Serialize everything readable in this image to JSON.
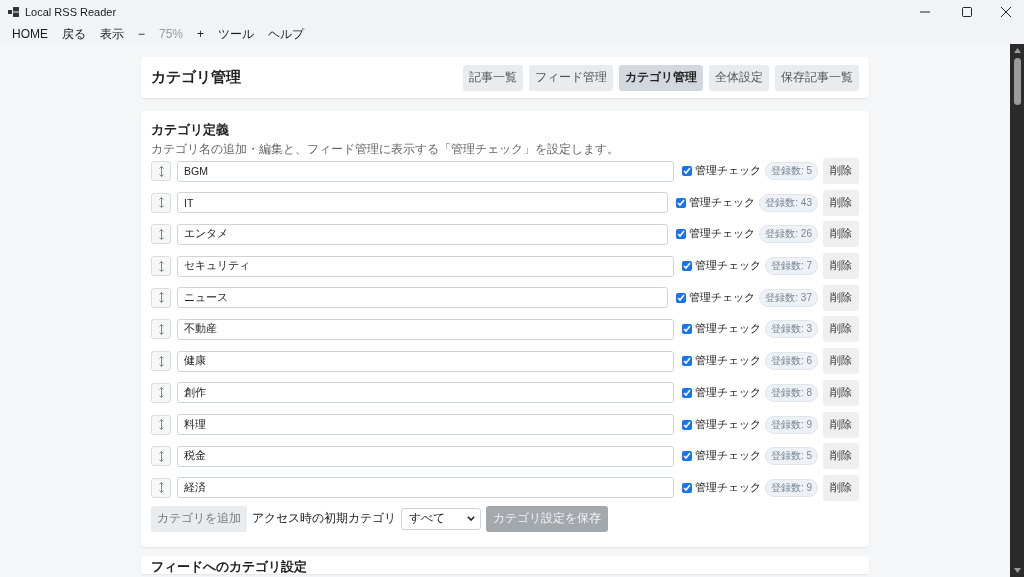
{
  "window": {
    "title": "Local RSS Reader"
  },
  "menu": [
    {
      "label": "HOME",
      "disabled": false
    },
    {
      "label": "戻る",
      "disabled": false
    },
    {
      "label": "表示",
      "disabled": false
    },
    {
      "label": "−",
      "disabled": false
    },
    {
      "label": "75%",
      "disabled": true
    },
    {
      "label": "+",
      "disabled": false
    },
    {
      "label": "ツール",
      "disabled": false
    },
    {
      "label": "ヘルプ",
      "disabled": false
    }
  ],
  "header": {
    "title": "カテゴリ管理",
    "nav": [
      {
        "label": "記事一覧",
        "selected": false
      },
      {
        "label": "フィード管理",
        "selected": false
      },
      {
        "label": "カテゴリ管理",
        "selected": true
      },
      {
        "label": "全体設定",
        "selected": false
      },
      {
        "label": "保存記事一覧",
        "selected": false
      }
    ]
  },
  "category_section": {
    "title": "カテゴリ定義",
    "description": "カテゴリ名の追加・編集と、フィード管理に表示する「管理チェック」を設定します。",
    "rows": [
      {
        "name": "BGM",
        "managed": true,
        "check_label": "管理チェック",
        "count": "登録数: 5",
        "delete": "削除"
      },
      {
        "name": "IT",
        "managed": true,
        "check_label": "管理チェック",
        "count": "登録数: 43",
        "delete": "削除"
      },
      {
        "name": "エンタメ",
        "managed": true,
        "check_label": "管理チェック",
        "count": "登録数: 26",
        "delete": "削除"
      },
      {
        "name": "セキュリティ",
        "managed": true,
        "check_label": "管理チェック",
        "count": "登録数: 7",
        "delete": "削除"
      },
      {
        "name": "ニュース",
        "managed": true,
        "check_label": "管理チェック",
        "count": "登録数: 37",
        "delete": "削除"
      },
      {
        "name": "不動産",
        "managed": true,
        "check_label": "管理チェック",
        "count": "登録数: 3",
        "delete": "削除"
      },
      {
        "name": "健康",
        "managed": true,
        "check_label": "管理チェック",
        "count": "登録数: 6",
        "delete": "削除"
      },
      {
        "name": "創作",
        "managed": true,
        "check_label": "管理チェック",
        "count": "登録数: 8",
        "delete": "削除"
      },
      {
        "name": "料理",
        "managed": true,
        "check_label": "管理チェック",
        "count": "登録数: 9",
        "delete": "削除"
      },
      {
        "name": "税金",
        "managed": true,
        "check_label": "管理チェック",
        "count": "登録数: 5",
        "delete": "削除"
      },
      {
        "name": "経済",
        "managed": true,
        "check_label": "管理チェック",
        "count": "登録数: 9",
        "delete": "削除"
      }
    ],
    "add_button": "カテゴリを追加",
    "default_label": "アクセス時の初期カテゴリ",
    "default_value": "すべて",
    "save_button": {
      "label": "カテゴリ設定を保存",
      "disabled": true
    }
  },
  "feed_section": {
    "title": "フィードへのカテゴリ設定"
  }
}
